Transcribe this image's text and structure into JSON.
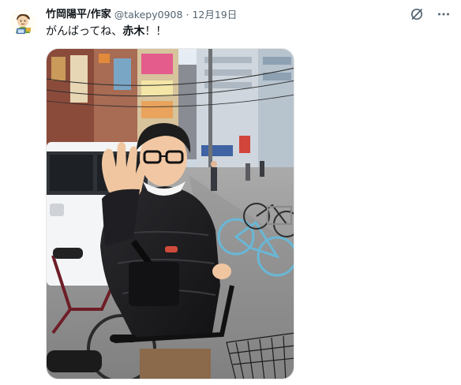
{
  "post": {
    "author": {
      "display_name": "竹岡陽平/作家",
      "handle": "@takepy0908",
      "separator": "·",
      "date": "12月19日",
      "avatar_icon": "cartoon-avatar-icon"
    },
    "text": {
      "prefix": "がんばってね、",
      "emphasis": "赤木",
      "suffix": "！！"
    },
    "media": {
      "icon": "street-photo-image"
    },
    "actions": {
      "grok_icon": "grok-icon",
      "more_icon": "more-options-icon",
      "more_label": "···"
    }
  },
  "colors": {
    "text_primary": "#0f1419",
    "text_secondary": "#536471",
    "background": "#ffffff"
  }
}
